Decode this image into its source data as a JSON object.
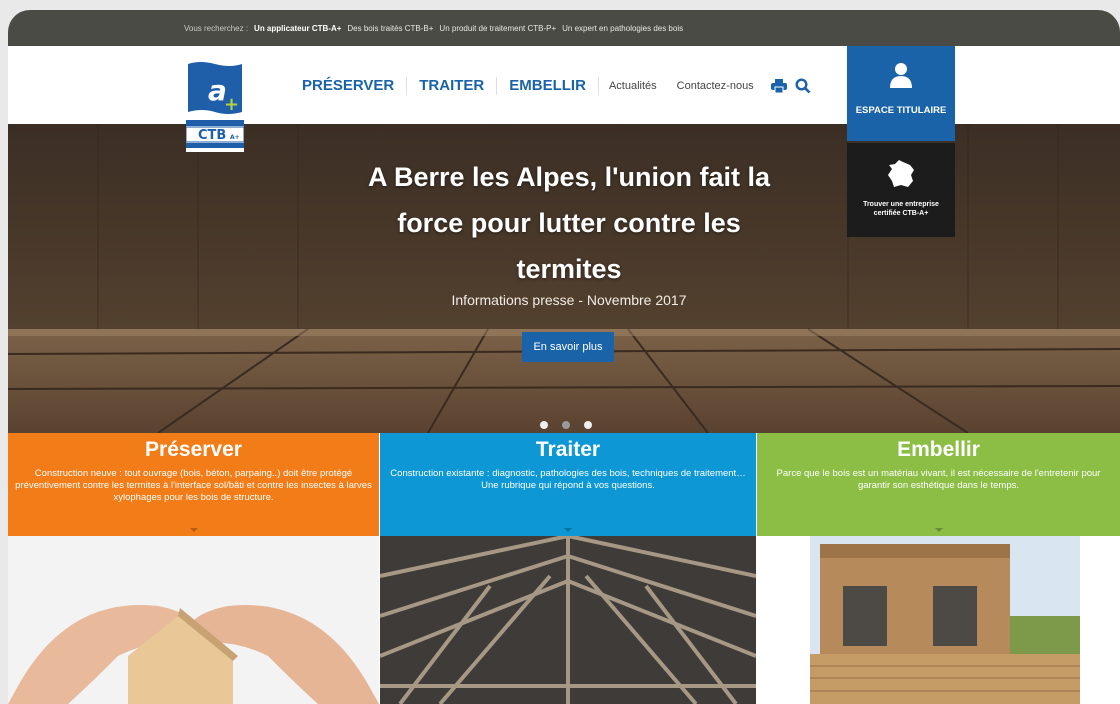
{
  "topbar": {
    "lead": "Vous recherchez :",
    "items": [
      {
        "label": "Un applicateur CTB-A+",
        "active": true
      },
      {
        "label": "Des bois traités CTB-B+",
        "active": false
      },
      {
        "label": "Un produit de traitement CTB-P+",
        "active": false
      },
      {
        "label": "Un expert en pathologies des bois",
        "active": false
      }
    ]
  },
  "logo": {
    "mark": "a",
    "plus": "+",
    "cert_text": "CTB",
    "cert_sub": "A+"
  },
  "nav": {
    "main": [
      "PRÉSERVER",
      "TRAITER",
      "EMBELLIR"
    ],
    "secondary": [
      "Actualités",
      "Contactez-nous"
    ],
    "icons": [
      "print-icon",
      "search-icon"
    ]
  },
  "espace": {
    "label": "ESPACE TITULAIRE",
    "icon": "user-icon"
  },
  "trouver": {
    "label": "Trouver une entreprise certifiée CTB-A+",
    "icon": "france-map-icon"
  },
  "hero": {
    "title": "A Berre les Alpes, l'union fait la force pour lutter contre les termites",
    "subtitle": "Informations presse - Novembre 2017",
    "button": "En savoir plus",
    "slides": 3,
    "active_slide": 2
  },
  "columns": [
    {
      "title": "Préserver",
      "text": "Construction neuve : tout ouvrage (bois, béton, parpaing..) doit être protégé préventivement contre les termites à l'interface sol/bâti et contre les insectes à larves xylophages pour les bois de structure.",
      "color": "#f27c17"
    },
    {
      "title": "Traiter",
      "text": "Construction existante : diagnostic, pathologies des bois, techniques de traitement… Une rubrique qui répond à vos questions.",
      "color": "#0d97d4"
    },
    {
      "title": "Embellir",
      "text": "Parce que le bois est un matériau vivant, il est nécessaire de l'entretenir pour garantir son esthétique dans le temps.",
      "color": "#8cbd45"
    }
  ],
  "colors": {
    "brand_blue": "#1a63a8",
    "topbar": "#4b4b45"
  }
}
